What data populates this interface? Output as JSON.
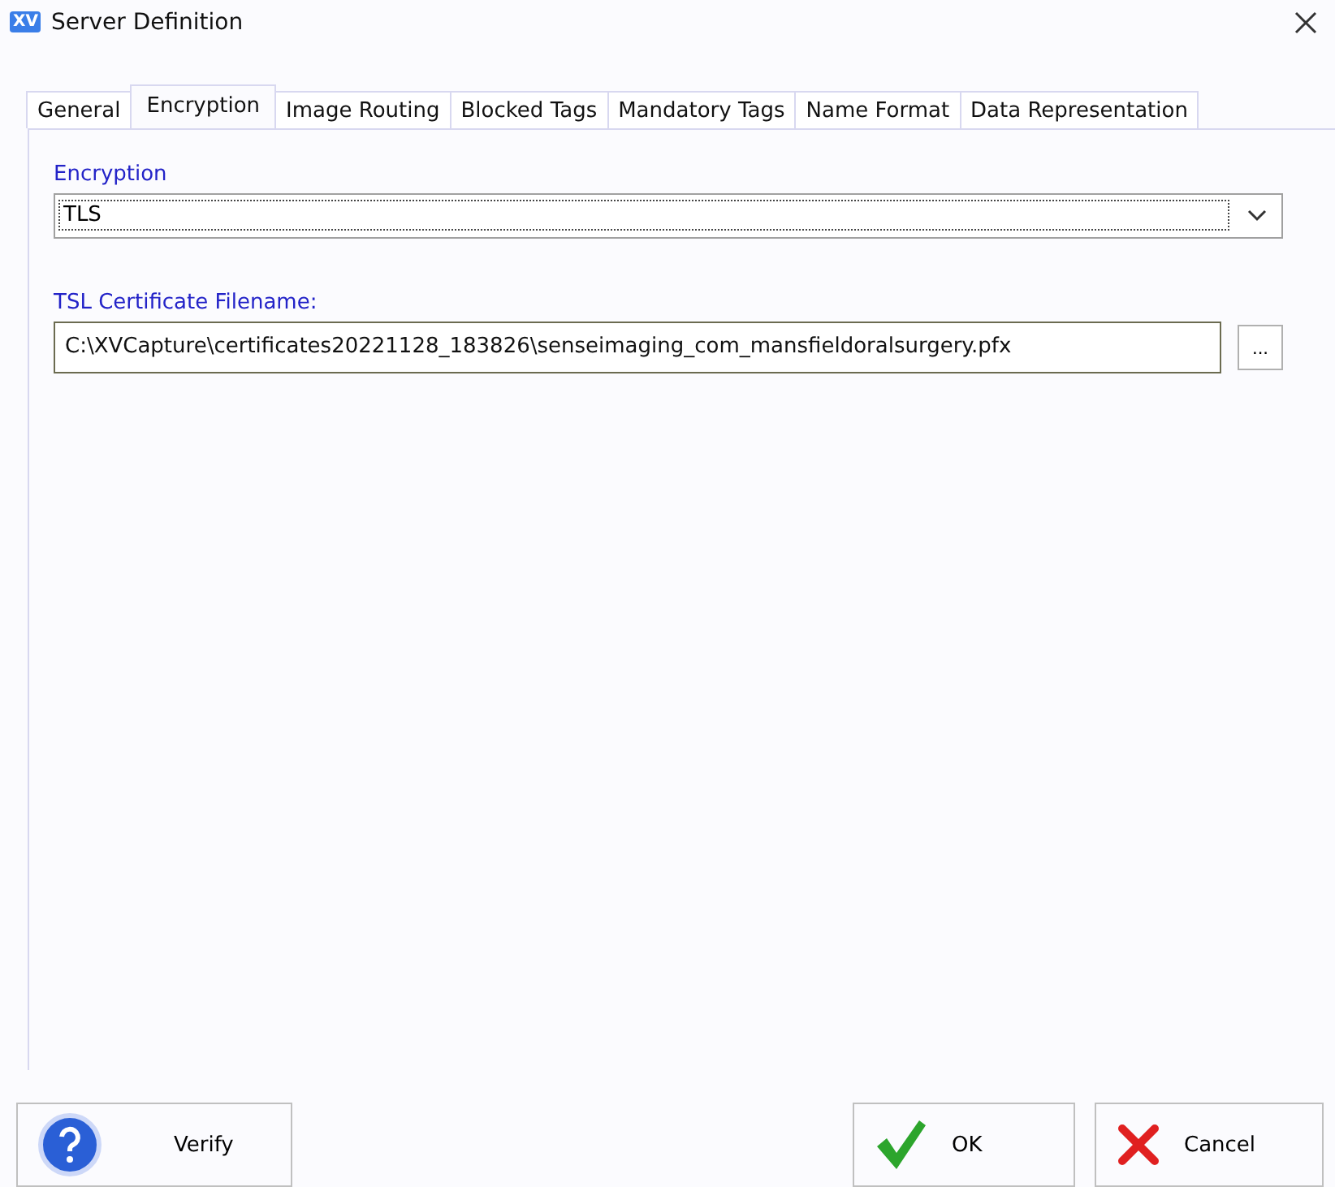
{
  "window": {
    "title": "Server Definition",
    "logo": "XV"
  },
  "tabs": [
    {
      "label": "General",
      "selected": false
    },
    {
      "label": "Encryption",
      "selected": true
    },
    {
      "label": "Image Routing",
      "selected": false
    },
    {
      "label": "Blocked Tags",
      "selected": false
    },
    {
      "label": "Mandatory Tags",
      "selected": false
    },
    {
      "label": "Name Format",
      "selected": false
    },
    {
      "label": "Data Representation",
      "selected": false
    }
  ],
  "encryption": {
    "label": "Encryption",
    "value": "TLS"
  },
  "certificate": {
    "label": "TSL Certificate Filename:",
    "value": "C:\\XVCapture\\certificates20221128_183826\\senseimaging_com_mansfieldoralsurgery.pfx",
    "browse": "..."
  },
  "buttons": [
    {
      "kind": "verify",
      "label": "Verify"
    },
    {
      "kind": "ok",
      "label": "OK"
    },
    {
      "kind": "cancel",
      "label": "Cancel"
    }
  ]
}
